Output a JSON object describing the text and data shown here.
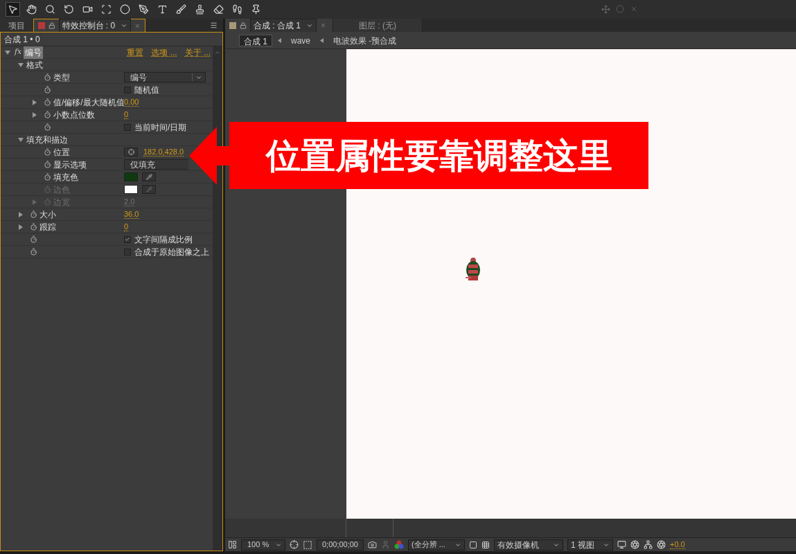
{
  "toolbar": {
    "tools": [
      {
        "kind": "select",
        "selected": true
      },
      {
        "kind": "hand",
        "selected": false
      },
      {
        "kind": "zoom",
        "selected": false
      },
      {
        "kind": "rotate",
        "selected": false
      },
      {
        "kind": "camera",
        "selected": false
      },
      {
        "kind": "pan",
        "selected": false
      },
      {
        "kind": "ellipse",
        "selected": false
      },
      {
        "kind": "pen",
        "selected": false
      },
      {
        "kind": "text",
        "selected": false
      },
      {
        "kind": "brush",
        "selected": false
      },
      {
        "kind": "stamp",
        "selected": false
      },
      {
        "kind": "eraser",
        "selected": false
      },
      {
        "kind": "puppet",
        "selected": false
      },
      {
        "kind": "pin",
        "selected": false
      }
    ]
  },
  "left_panel": {
    "tabs": [
      {
        "label": "项目",
        "selected": false
      },
      {
        "label": "特效控制台 : 0",
        "selected": true,
        "color": "#b43a3a"
      }
    ],
    "header": "合成 1 • 0",
    "effect": {
      "fx_label": "fx",
      "name": "编号",
      "links": [
        "重置",
        "选项 ...",
        "关于 ..."
      ],
      "expanded": true,
      "children": [
        {
          "kind": "group",
          "label": "格式",
          "expanded": true,
          "children": [
            {
              "kind": "property",
              "label": "类型",
              "disabled": false,
              "control": {
                "kind": "dropdown",
                "value": "编号"
              }
            },
            {
              "kind": "property",
              "disabled": false,
              "control": {
                "kind": "checkbox",
                "label": "随机值",
                "checked": false
              }
            },
            {
              "kind": "property",
              "label": "值/偏移/最大随机值",
              "disabled": false,
              "expanded": false,
              "control": {
                "kind": "value",
                "value": "0.00"
              }
            },
            {
              "kind": "property",
              "label": "小数点位数",
              "disabled": false,
              "expanded": false,
              "control": {
                "kind": "value",
                "value": "0"
              }
            },
            {
              "kind": "property",
              "disabled": false,
              "control": {
                "kind": "checkbox",
                "label": "当前时间/日期",
                "checked": false
              }
            }
          ]
        },
        {
          "kind": "group",
          "label": "填充和描边",
          "expanded": true,
          "children": [
            {
              "kind": "property",
              "label": "位置",
              "disabled": false,
              "control": {
                "kind": "point",
                "value": "182.0,428.0"
              }
            },
            {
              "kind": "property",
              "label": "显示选项",
              "disabled": false,
              "control": {
                "kind": "dropdown",
                "value": "仅填充"
              }
            },
            {
              "kind": "property",
              "label": "填充色",
              "disabled": false,
              "control": {
                "kind": "color",
                "color": "#0f3a0f"
              }
            },
            {
              "kind": "property",
              "label": "边色",
              "disabled": true,
              "control": {
                "kind": "color",
                "color": "#ffffff"
              }
            },
            {
              "kind": "property",
              "label": "边宽",
              "disabled": true,
              "expanded": false,
              "control": {
                "kind": "value",
                "value": "2.0"
              }
            }
          ]
        },
        {
          "kind": "property",
          "label": "大小",
          "disabled": false,
          "expanded": false,
          "control": {
            "kind": "value",
            "value": "36.0"
          }
        },
        {
          "kind": "property",
          "label": "跟踪",
          "disabled": false,
          "expanded": false,
          "control": {
            "kind": "value",
            "value": "0"
          }
        },
        {
          "kind": "property",
          "disabled": false,
          "control": {
            "kind": "checkbox",
            "label": "文字间隔成比例",
            "checked": true
          }
        },
        {
          "kind": "property",
          "disabled": false,
          "control": {
            "kind": "checkbox",
            "label": "合成于原始图像之上",
            "checked": false
          }
        }
      ]
    }
  },
  "right_panel": {
    "tabs": [
      {
        "label": "合成 : 合成 1",
        "selected": true,
        "color": "#a89878"
      },
      {
        "label": "图层 : (无)",
        "selected": false
      }
    ],
    "breadcrumbs": [
      {
        "label": "合成 1",
        "selected": true
      },
      {
        "label": "wave",
        "selected": false
      },
      {
        "label": "电波效果 -预合成",
        "selected": false
      }
    ],
    "callout": "位置属性要靠调整这里",
    "bottom_bar": {
      "zoom": "100 %",
      "timecode": "0;00;00;00",
      "resolution": "(全分辨 ...",
      "camera": "有效摄像机",
      "views": "1 视图",
      "exposure": "+0.0"
    }
  }
}
